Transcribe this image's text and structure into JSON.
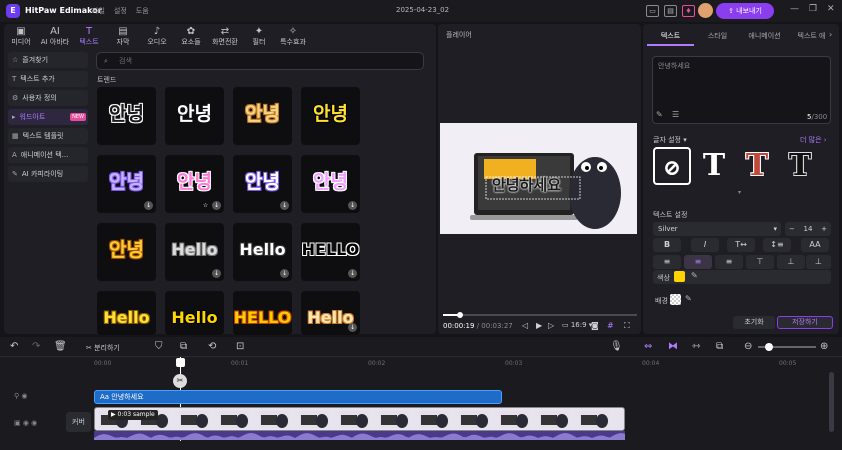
{
  "app": {
    "name": "HitPaw Edimakor",
    "menu": [
      "파일",
      "설정",
      "도움"
    ],
    "doc_title": "2025-04-23_02",
    "export_label": "내보내기"
  },
  "tools": [
    {
      "icon": "media-icon",
      "glyph": "▣",
      "label": "미디어"
    },
    {
      "icon": "ai-avatar-icon",
      "glyph": "AI",
      "label": "AI 아바타"
    },
    {
      "icon": "text-icon",
      "glyph": "T",
      "label": "텍스트"
    },
    {
      "icon": "subtitle-icon",
      "glyph": "▤",
      "label": "자막"
    },
    {
      "icon": "audio-icon",
      "glyph": "♪",
      "label": "오디오"
    },
    {
      "icon": "elements-icon",
      "glyph": "✿",
      "label": "요소들"
    },
    {
      "icon": "transition-icon",
      "glyph": "⇄",
      "label": "화면전환"
    },
    {
      "icon": "filter-icon",
      "glyph": "✦",
      "label": "필터"
    },
    {
      "icon": "effects-icon",
      "glyph": "✧",
      "label": "특수효과"
    }
  ],
  "sidebar": [
    {
      "label": "즐겨찾기",
      "icon": "star-icon",
      "glyph": "☆"
    },
    {
      "label": "텍스트 추가",
      "icon": "add-text-icon",
      "glyph": "T"
    },
    {
      "label": "사용자 정의",
      "icon": "custom-icon",
      "glyph": "⚙"
    },
    {
      "label": "워드아트",
      "icon": "wordart-icon",
      "glyph": "▸",
      "badge": "NEW"
    },
    {
      "label": "텍스트 템플릿",
      "icon": "template-icon",
      "glyph": "▦"
    },
    {
      "label": "애니메이션 텍...",
      "icon": "animation-icon",
      "glyph": "A"
    },
    {
      "label": "AI 카피라이팅",
      "icon": "ai-copy-icon",
      "glyph": "✎"
    }
  ],
  "search": {
    "placeholder": "검색"
  },
  "section_trend": "트렌드",
  "tiles": [
    {
      "text": "안녕",
      "color": "#1a1a1a",
      "stroke": "#ffffff",
      "dl": false
    },
    {
      "text": "안녕",
      "color": "#ffffff",
      "stroke": "",
      "dl": false
    },
    {
      "text": "안녕",
      "color": "#f5d48a",
      "stroke": "#c07a20",
      "dl": false
    },
    {
      "text": "안녕",
      "color": "#ffe033",
      "stroke": "#000",
      "dl": false
    },
    {
      "text": "안녕",
      "color": "#c9b3ff",
      "stroke": "#7e5cf0",
      "dl": true
    },
    {
      "text": "안녕",
      "color": "#ff7ad9",
      "stroke": "#ffffff",
      "dl": true,
      "fav": true
    },
    {
      "text": "안녕",
      "color": "#ffffff",
      "stroke": "#7e5cf0",
      "dl": true
    },
    {
      "text": "안녕",
      "color": "#f0a0ff",
      "stroke": "#ffffff",
      "dl": true
    },
    {
      "text": "안녕",
      "color": "#ffcc33",
      "stroke": "#a05000",
      "dl": false
    },
    {
      "text": "Hello",
      "color": "#dcdcdc",
      "stroke": "#777",
      "dl": true
    },
    {
      "text": "Hello",
      "color": "#ffffff",
      "stroke": "#333",
      "dl": true
    },
    {
      "text": "HELLO",
      "color": "#000000",
      "stroke": "#ffffff",
      "dl": true
    },
    {
      "text": "Hello",
      "color": "#ffe033",
      "stroke": "#8a6000",
      "dl": false
    },
    {
      "text": "Hello",
      "color": "#ffd700",
      "stroke": "#000",
      "dl": false
    },
    {
      "text": "HELLO",
      "color": "#ffcc00",
      "stroke": "#c04000",
      "dl": false
    },
    {
      "text": "Hello",
      "color": "#ffe8b0",
      "stroke": "#d08030",
      "dl": true
    }
  ],
  "player": {
    "label": "플레이어",
    "current": "00:00:19",
    "total": "00:03:27",
    "ratio": "16:9",
    "progress_fraction": 0.09,
    "overlay_text": "안녕하세요"
  },
  "inspector": {
    "tabs": [
      "텍스트",
      "스타일",
      "애니메이션",
      "텍스트 애"
    ],
    "text_value": "안녕하세요",
    "char_count": "5",
    "char_max": "/300",
    "preset_label": "글자 설정",
    "more_label": "더 많은",
    "text_settings_label": "텍스트 설정",
    "font": "Silver",
    "font_size": "14",
    "color_label": "색상",
    "color_value": "#ffd400",
    "bg_label": "배경",
    "reset": "초기화",
    "save": "저장하기"
  },
  "timeline": {
    "split_label": "분리하기",
    "ticks": [
      "00:00",
      "00:01",
      "00:02",
      "00:03",
      "00:04",
      "00:05"
    ],
    "text_clip": "Aa 안녕하세요",
    "video_clip_time": "0:03",
    "video_clip_name": "sample",
    "cover_label": "커버"
  },
  "accent": "#8b3df0"
}
